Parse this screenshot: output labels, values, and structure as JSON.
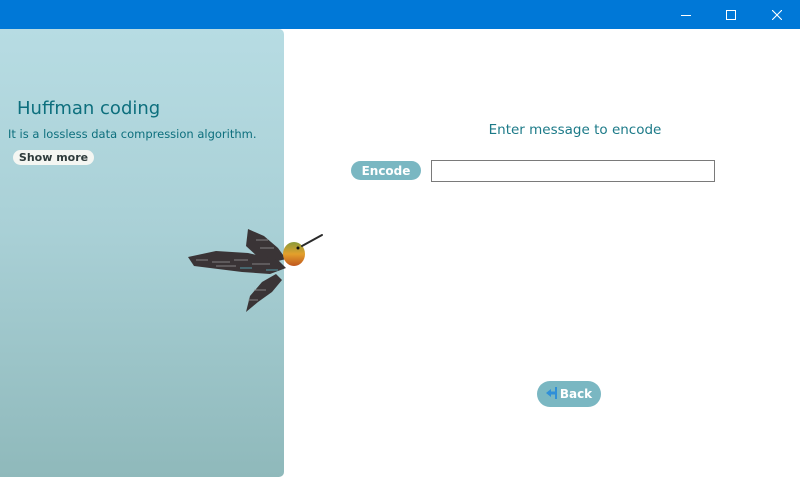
{
  "window": {
    "buttons": {
      "minimize_icon": "minimize-icon",
      "maximize_icon": "maximize-icon",
      "close_icon": "close-icon"
    },
    "titlebar_color": "#0078d7"
  },
  "sidebar": {
    "title": "Huffman coding",
    "description": "It is a lossless data compression algorithm.",
    "show_more_label": "Show more",
    "illustration": "hummingbird-code-illustration"
  },
  "main": {
    "prompt": "Enter message to encode",
    "encode_label": "Encode",
    "input_value": "",
    "back_label": "Back",
    "back_icon": "back-arrow-icon"
  },
  "colors": {
    "accent": "#7ab7c2",
    "text_teal": "#0d6f7d"
  }
}
